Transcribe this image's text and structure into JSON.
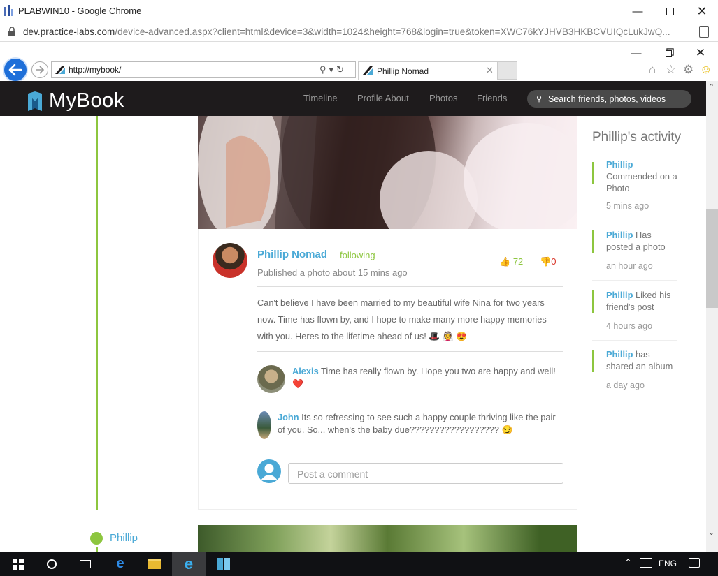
{
  "chrome": {
    "window_title": "PLABWIN10 - Google Chrome",
    "url_host": "dev.practice-labs.com",
    "url_rest": "/device-advanced.aspx?client=html&device=3&width=1024&height=768&login=true&token=XWC76kYJHVB3HKBCVUIQcLukJwQ..."
  },
  "ie": {
    "address": "http://mybook/",
    "tab_title": "Phillip Nomad"
  },
  "site": {
    "brand": "MyBook",
    "nav": [
      "Timeline",
      "Profile About",
      "Photos",
      "Friends"
    ],
    "search_placeholder": "Search friends, photos, videos"
  },
  "post": {
    "author": "Phillip Nomad",
    "following": "following",
    "published": "Published a photo about 15 mins ago",
    "likes": "72",
    "dislikes": "0",
    "text": "Can't believe I have been married to my beautiful wife Nina for two years now. Time has flown by, and I hope to make many more happy memories with you. Heres to the lifetime ahead of us! 🎩 👰 😍",
    "comments": [
      {
        "name": "Alexis",
        "text": "Time has really flown by. Hope you two are happy and well! ❤️"
      },
      {
        "name": "John",
        "text": "Its so refressing to see such a happy couple thriving like the pair of you. So... when's the baby due?????????????????? 😏"
      }
    ],
    "comment_placeholder": "Post a comment"
  },
  "timeline": {
    "next_name": "Phillip"
  },
  "activity": {
    "title": "Phillip's activity",
    "items": [
      {
        "name": "Phillip",
        "text": "Commended on a Photo",
        "time": "5 mins ago"
      },
      {
        "name": "Phillip",
        "text": "Has posted a photo",
        "time": "an hour ago"
      },
      {
        "name": "Phillip",
        "text": "Liked his friend's post",
        "time": "4 hours ago"
      },
      {
        "name": "Phillip",
        "text": "has shared an album",
        "time": "a day ago"
      }
    ]
  },
  "taskbar": {
    "language": "ENG"
  },
  "colors": {
    "accent_blue": "#4aa9d6",
    "accent_green": "#8dc63f",
    "nav_bg": "#1e1b1c",
    "dislike_red": "#d9362a"
  }
}
